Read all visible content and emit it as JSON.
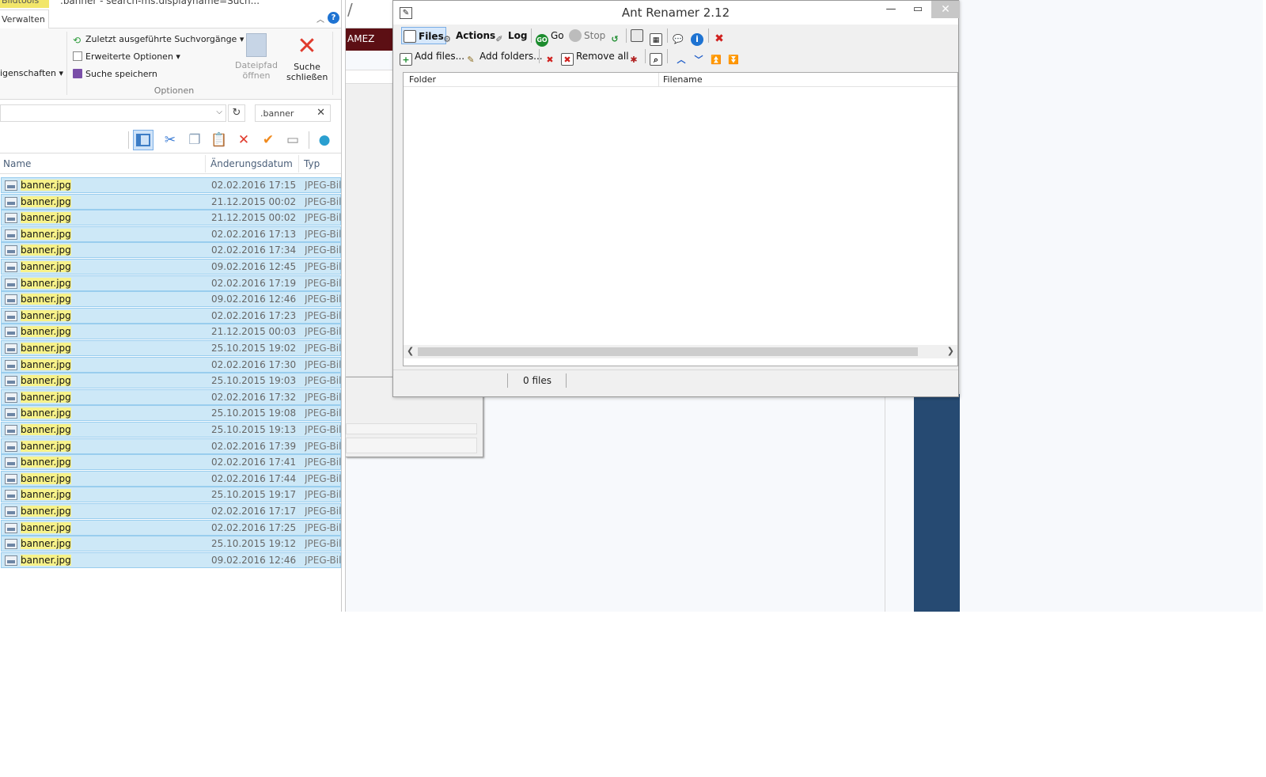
{
  "explorer": {
    "context_tab": "Bildtools",
    "title": ".banner - search-ms:displayname=Such...",
    "tab_manage": "Verwalten",
    "ribbon": {
      "props_label": "igenschaften",
      "recent_searches": "Zuletzt ausgeführte Suchvorgänge",
      "advanced_options": "Erweiterte Optionen",
      "save_search": "Suche speichern",
      "open_path_line1": "Dateipfad",
      "open_path_line2": "öffnen",
      "close_search_line1": "Suche",
      "close_search_line2": "schließen",
      "group_label": "Optionen"
    },
    "search_value": ".banner",
    "columns": {
      "name": "Name",
      "date": "Änderungsdatum",
      "type": "Typ"
    },
    "files": [
      {
        "name": "banner.jpg",
        "date": "02.02.2016 17:15",
        "type": "JPEG-Bild"
      },
      {
        "name": "banner.jpg",
        "date": "21.12.2015 00:02",
        "type": "JPEG-Bild"
      },
      {
        "name": "banner.jpg",
        "date": "21.12.2015 00:02",
        "type": "JPEG-Bild"
      },
      {
        "name": "banner.jpg",
        "date": "02.02.2016 17:13",
        "type": "JPEG-Bild"
      },
      {
        "name": "banner.jpg",
        "date": "02.02.2016 17:34",
        "type": "JPEG-Bild"
      },
      {
        "name": "banner.jpg",
        "date": "09.02.2016 12:45",
        "type": "JPEG-Bild"
      },
      {
        "name": "banner.jpg",
        "date": "02.02.2016 17:19",
        "type": "JPEG-Bild"
      },
      {
        "name": "banner.jpg",
        "date": "09.02.2016 12:46",
        "type": "JPEG-Bild"
      },
      {
        "name": "banner.jpg",
        "date": "02.02.2016 17:23",
        "type": "JPEG-Bild"
      },
      {
        "name": "banner.jpg",
        "date": "21.12.2015 00:03",
        "type": "JPEG-Bild"
      },
      {
        "name": "banner.jpg",
        "date": "25.10.2015 19:02",
        "type": "JPEG-Bild"
      },
      {
        "name": "banner.jpg",
        "date": "02.02.2016 17:30",
        "type": "JPEG-Bild"
      },
      {
        "name": "banner.jpg",
        "date": "25.10.2015 19:03",
        "type": "JPEG-Bild"
      },
      {
        "name": "banner.jpg",
        "date": "02.02.2016 17:32",
        "type": "JPEG-Bild"
      },
      {
        "name": "banner.jpg",
        "date": "25.10.2015 19:08",
        "type": "JPEG-Bild"
      },
      {
        "name": "banner.jpg",
        "date": "25.10.2015 19:13",
        "type": "JPEG-Bild"
      },
      {
        "name": "banner.jpg",
        "date": "02.02.2016 17:39",
        "type": "JPEG-Bild"
      },
      {
        "name": "banner.jpg",
        "date": "02.02.2016 17:41",
        "type": "JPEG-Bild"
      },
      {
        "name": "banner.jpg",
        "date": "02.02.2016 17:44",
        "type": "JPEG-Bild"
      },
      {
        "name": "banner.jpg",
        "date": "25.10.2015 19:17",
        "type": "JPEG-Bild"
      },
      {
        "name": "banner.jpg",
        "date": "02.02.2016 17:17",
        "type": "JPEG-Bild"
      },
      {
        "name": "banner.jpg",
        "date": "02.02.2016 17:25",
        "type": "JPEG-Bild"
      },
      {
        "name": "banner.jpg",
        "date": "25.10.2015 19:12",
        "type": "JPEG-Bild"
      },
      {
        "name": "banner.jpg",
        "date": "09.02.2016 12:46",
        "type": "JPEG-Bild"
      }
    ]
  },
  "background": {
    "strip_text": "AMEZ",
    "slash": "/"
  },
  "ant": {
    "title": "Ant Renamer 2.12",
    "toolbar1": {
      "files": "Files",
      "actions": "Actions",
      "log": "Log",
      "go": "Go",
      "stop": "Stop"
    },
    "toolbar2": {
      "add_files": "Add files...",
      "add_folders": "Add folders...",
      "remove_all": "Remove all"
    },
    "columns": {
      "folder": "Folder",
      "filename": "Filename"
    },
    "status": "0 files",
    "colors": {
      "accent": "#1e73d2",
      "close": "#e03b2d",
      "selection": "#cde8f7"
    }
  }
}
